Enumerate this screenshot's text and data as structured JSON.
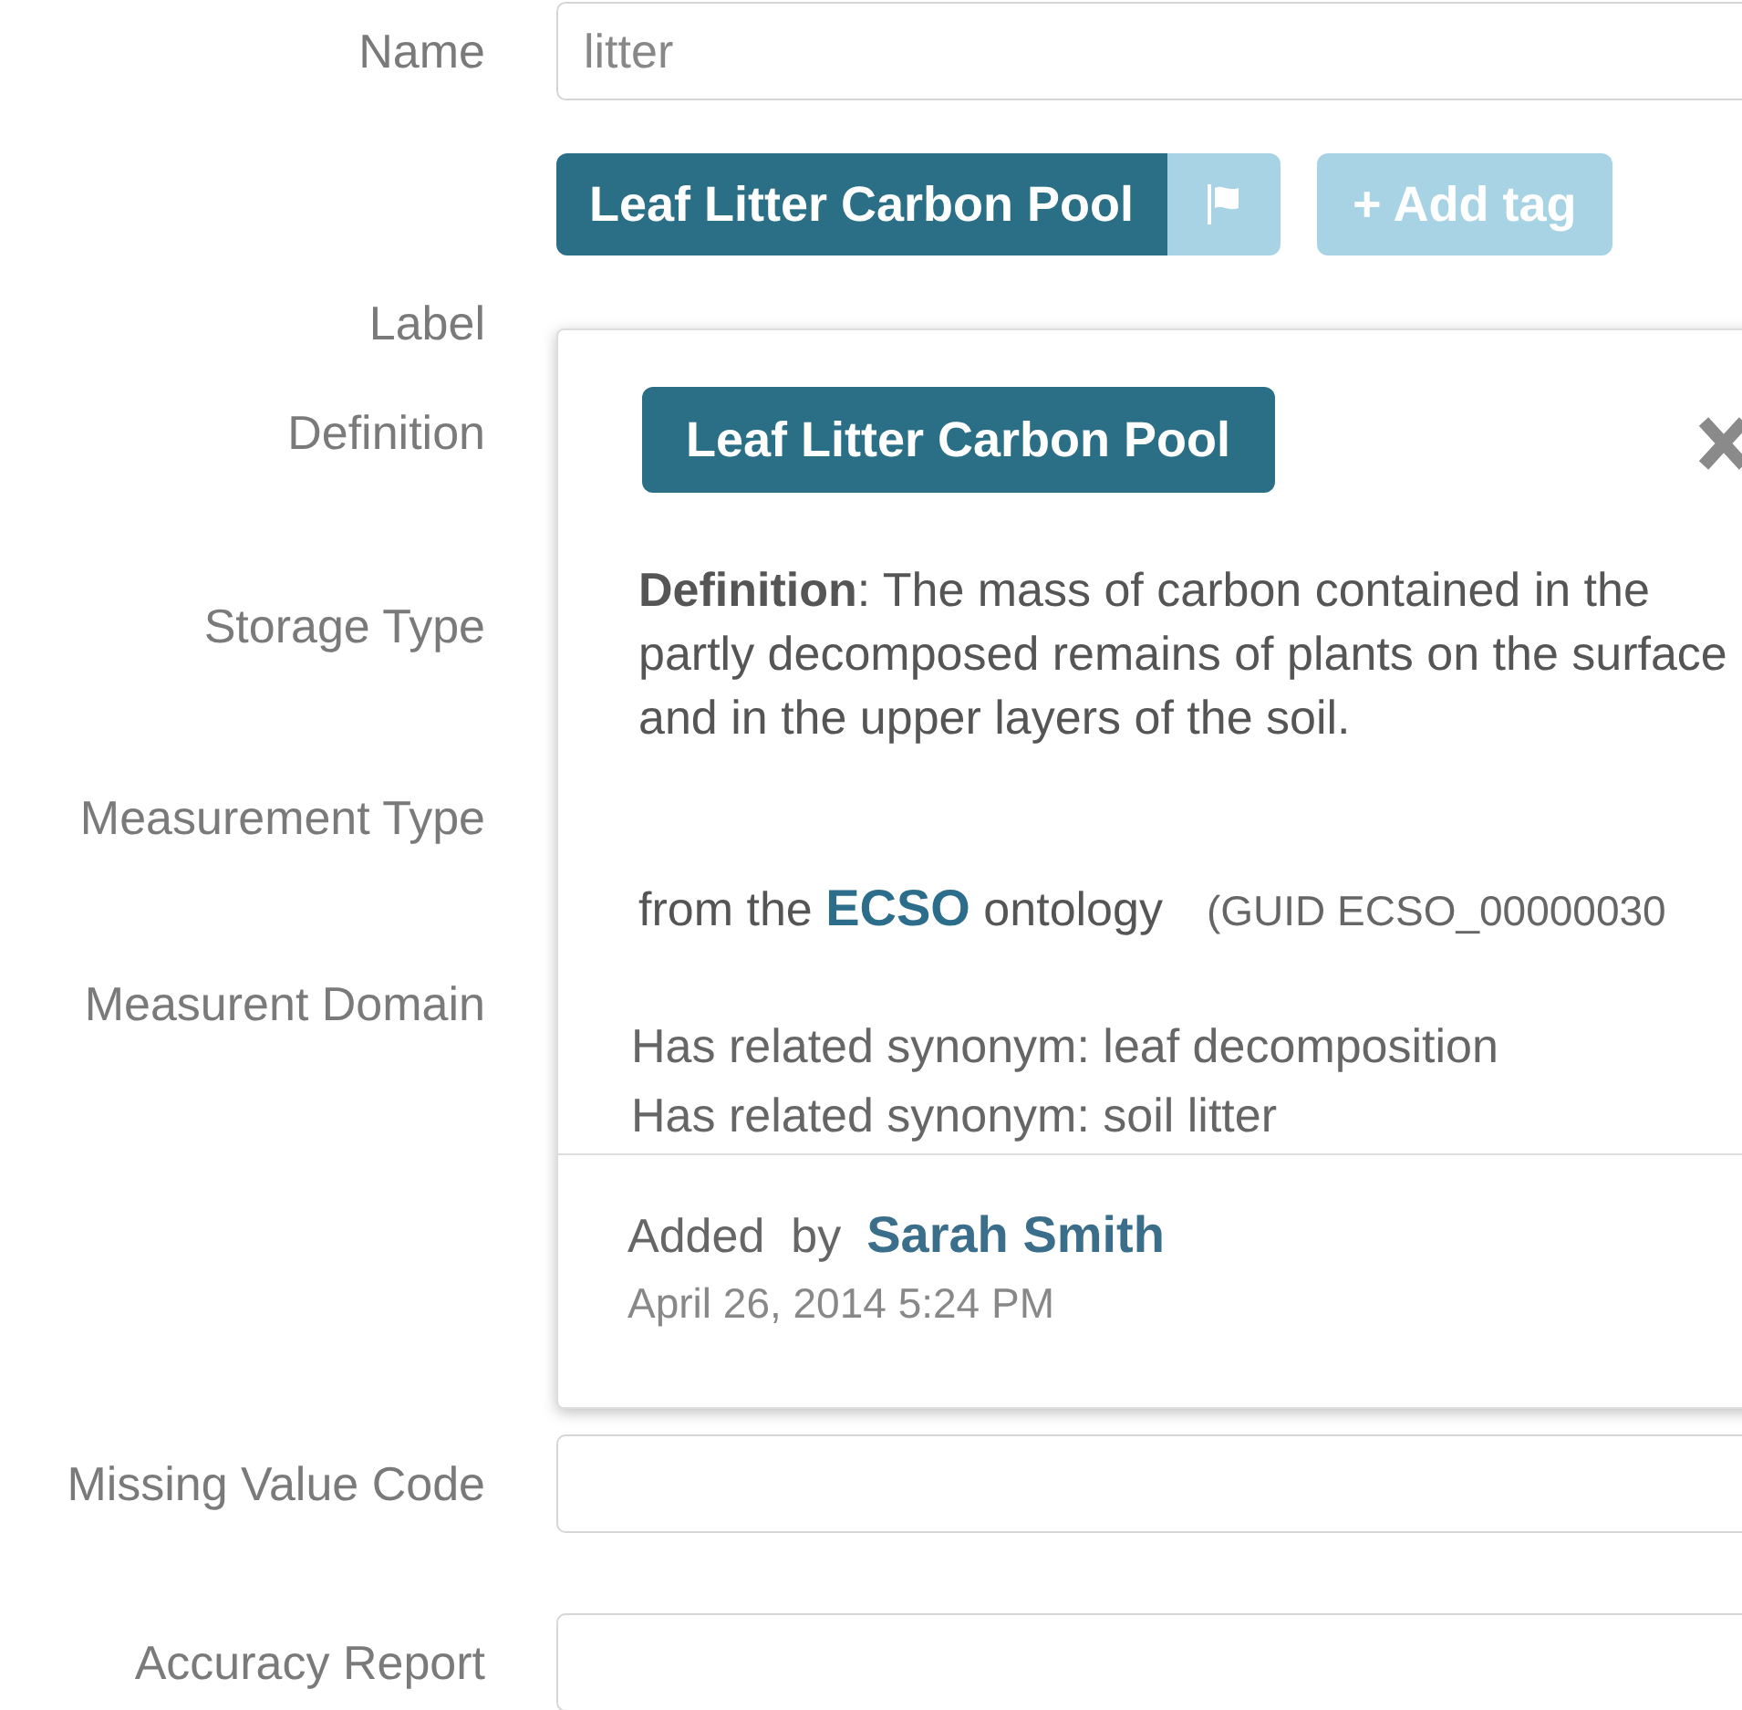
{
  "form": {
    "rows": [
      {
        "kind": "input",
        "label": "Name",
        "value": "litter"
      },
      {
        "kind": "tags",
        "tags": [
          {
            "text": "Leaf Litter Carbon Pool",
            "flagged": true
          }
        ],
        "add_button": "+ Add tag"
      },
      {
        "kind": "label",
        "label": "Label"
      },
      {
        "kind": "label",
        "label": "Definition"
      },
      {
        "kind": "label",
        "label": "Storage Type"
      },
      {
        "kind": "label",
        "label": "Measurement Type"
      },
      {
        "kind": "label",
        "label": "Measurent Domain"
      },
      {
        "kind": "input",
        "label": "Missing Value Code",
        "value": ""
      },
      {
        "kind": "input",
        "label": "Accuracy Report",
        "value": ""
      }
    ]
  },
  "popover": {
    "title": "Leaf Litter Carbon Pool",
    "definition": "**Definition**: The mass of carbon contained in the partly decomposed remains of plants on the surface and in the upper layers of the soil.",
    "source_prefix": "from the",
    "ontology": "ECSO",
    "source_suffix": "ontology",
    "guid": "(GUID ECSO_00000030",
    "synonyms": [
      "Has related synonym: leaf decomposition",
      "Has related synonym: soil litter"
    ],
    "added_by_label": "Added  by",
    "author": "Sarah Smith",
    "date": "April 26, 2014 5:24 PM"
  }
}
